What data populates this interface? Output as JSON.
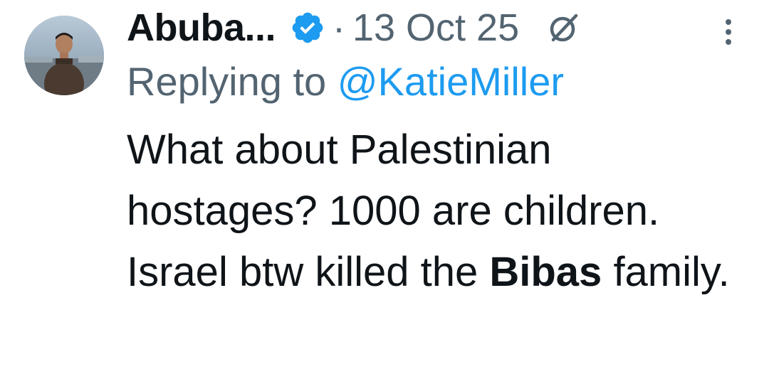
{
  "tweet": {
    "display_name": "Abuba...",
    "dot": "·",
    "date": "13 Oct 25",
    "replying_prefix": "Replying to",
    "replying_handle": "@KatieMiller",
    "text_before": "What about Palestinian hostages? 1000 are children. Israel btw killed the",
    "text_bold": "Bibas",
    "text_after": "family."
  },
  "icons": {
    "verified": "verified-badge-icon",
    "grok": "grok-icon",
    "more": "more-vertical-icon"
  },
  "colors": {
    "accent": "#1d9bf0",
    "secondary_text": "#536471",
    "primary_text": "#0f1419"
  }
}
